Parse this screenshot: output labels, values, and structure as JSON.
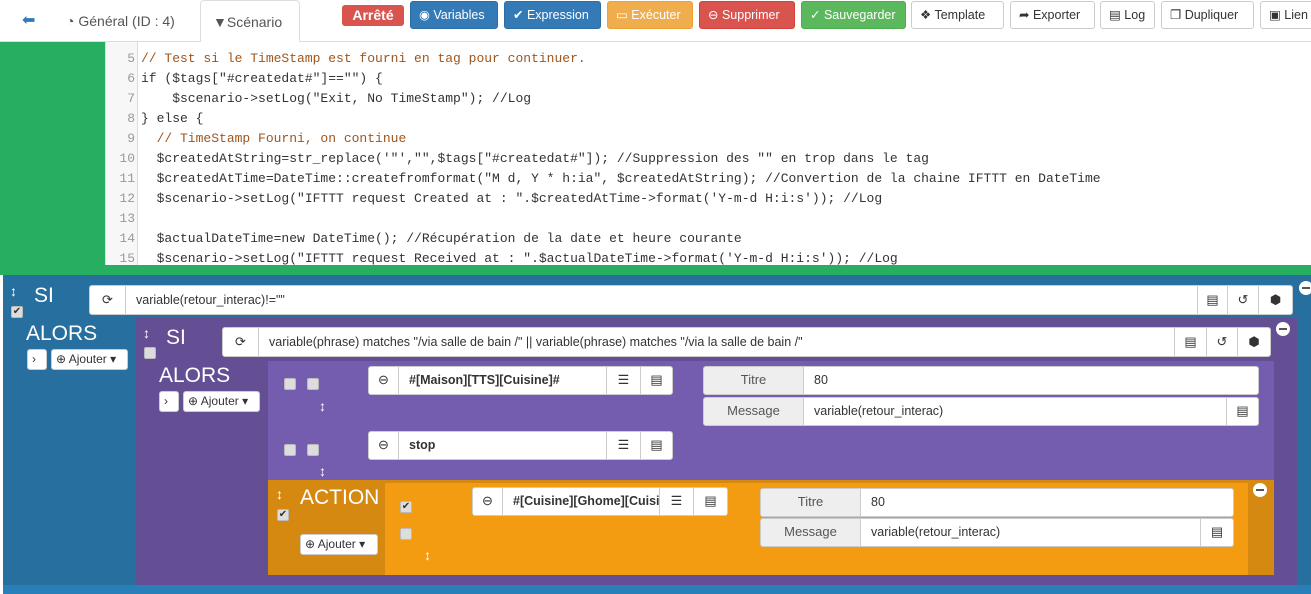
{
  "nav": {
    "back_icon": "arrow-circle-left-icon",
    "tabs": [
      {
        "label": "Général (ID : 4)",
        "icon": "dashboard-icon"
      },
      {
        "label": "Scénario",
        "icon": "filter-icon"
      }
    ]
  },
  "toolbar": {
    "status": "Arrêté",
    "buttons": {
      "variables": "Variables",
      "expression": "Expression",
      "executer": "Exécuter",
      "supprimer": "Supprimer",
      "sauvegarder": "Sauvegarder",
      "template": "Template",
      "exporter": "Exporter",
      "log": "Log",
      "dupliquer": "Dupliquer",
      "lien": "Lien"
    }
  },
  "code": {
    "lines": [
      {
        "n": "5",
        "text": "// Test si le TimeStamp est fourni en tag pour continuer."
      },
      {
        "n": "6",
        "text": "if ($tags[\"#createdat#\"]==\"\") {"
      },
      {
        "n": "7",
        "text": "    $scenario->setLog(\"Exit, No TimeStamp\"); //Log"
      },
      {
        "n": "8",
        "text": "} else {"
      },
      {
        "n": "9",
        "text": "  // TimeStamp Fourni, on continue"
      },
      {
        "n": "10",
        "text": "  $createdAtString=str_replace('\"',\"\",$tags[\"#createdat#\"]); //Suppression des \"\" en trop dans le tag"
      },
      {
        "n": "11",
        "text": "  $createdAtTime=DateTime::createfromformat(\"M d, Y * h:ia\", $createdAtString); //Convertion de la chaine IFTTT en DateTime"
      },
      {
        "n": "12",
        "text": "  $scenario->setLog(\"IFTTT request Created at : \".$createdAtTime->format('Y-m-d H:i:s')); //Log"
      },
      {
        "n": "13",
        "text": ""
      },
      {
        "n": "14",
        "text": "  $actualDateTime=new DateTime(); //Récupération de la date et heure courante"
      },
      {
        "n": "15",
        "text": "  $scenario->setLog(\"IFTTT request Received at : \".$actualDateTime->format('Y-m-d H:i:s')); //Log"
      }
    ]
  },
  "colors": {
    "green": "#27ae60",
    "blue": "#266f9e",
    "purple": "#644f94",
    "purple_inner": "#745cae",
    "orange": "#f39c12",
    "orange_dark": "#d68910"
  },
  "outer": {
    "si": "SI",
    "alors": "ALORS",
    "ajouter": "Ajouter",
    "condition": "variable(retour_interac)!=\"\""
  },
  "inner": {
    "si": "SI",
    "alors": "ALORS",
    "ajouter": "Ajouter",
    "condition": "variable(phrase) matches \"/via salle de bain /\" || variable(phrase) matches \"/via la salle de bain /\"",
    "actions": [
      {
        "cmd": "#[Maison][TTS][Cuisine]#",
        "titre_label": "Titre",
        "titre": "80",
        "message_label": "Message",
        "message": "variable(retour_interac)"
      },
      {
        "cmd": "stop"
      }
    ]
  },
  "action_block": {
    "title": "ACTION",
    "ajouter": "Ajouter",
    "cmd": "#[Cuisine][Ghome][Cuisine]#",
    "titre_label": "Titre",
    "titre": "80",
    "message_label": "Message",
    "message": "variable(retour_interac)"
  }
}
